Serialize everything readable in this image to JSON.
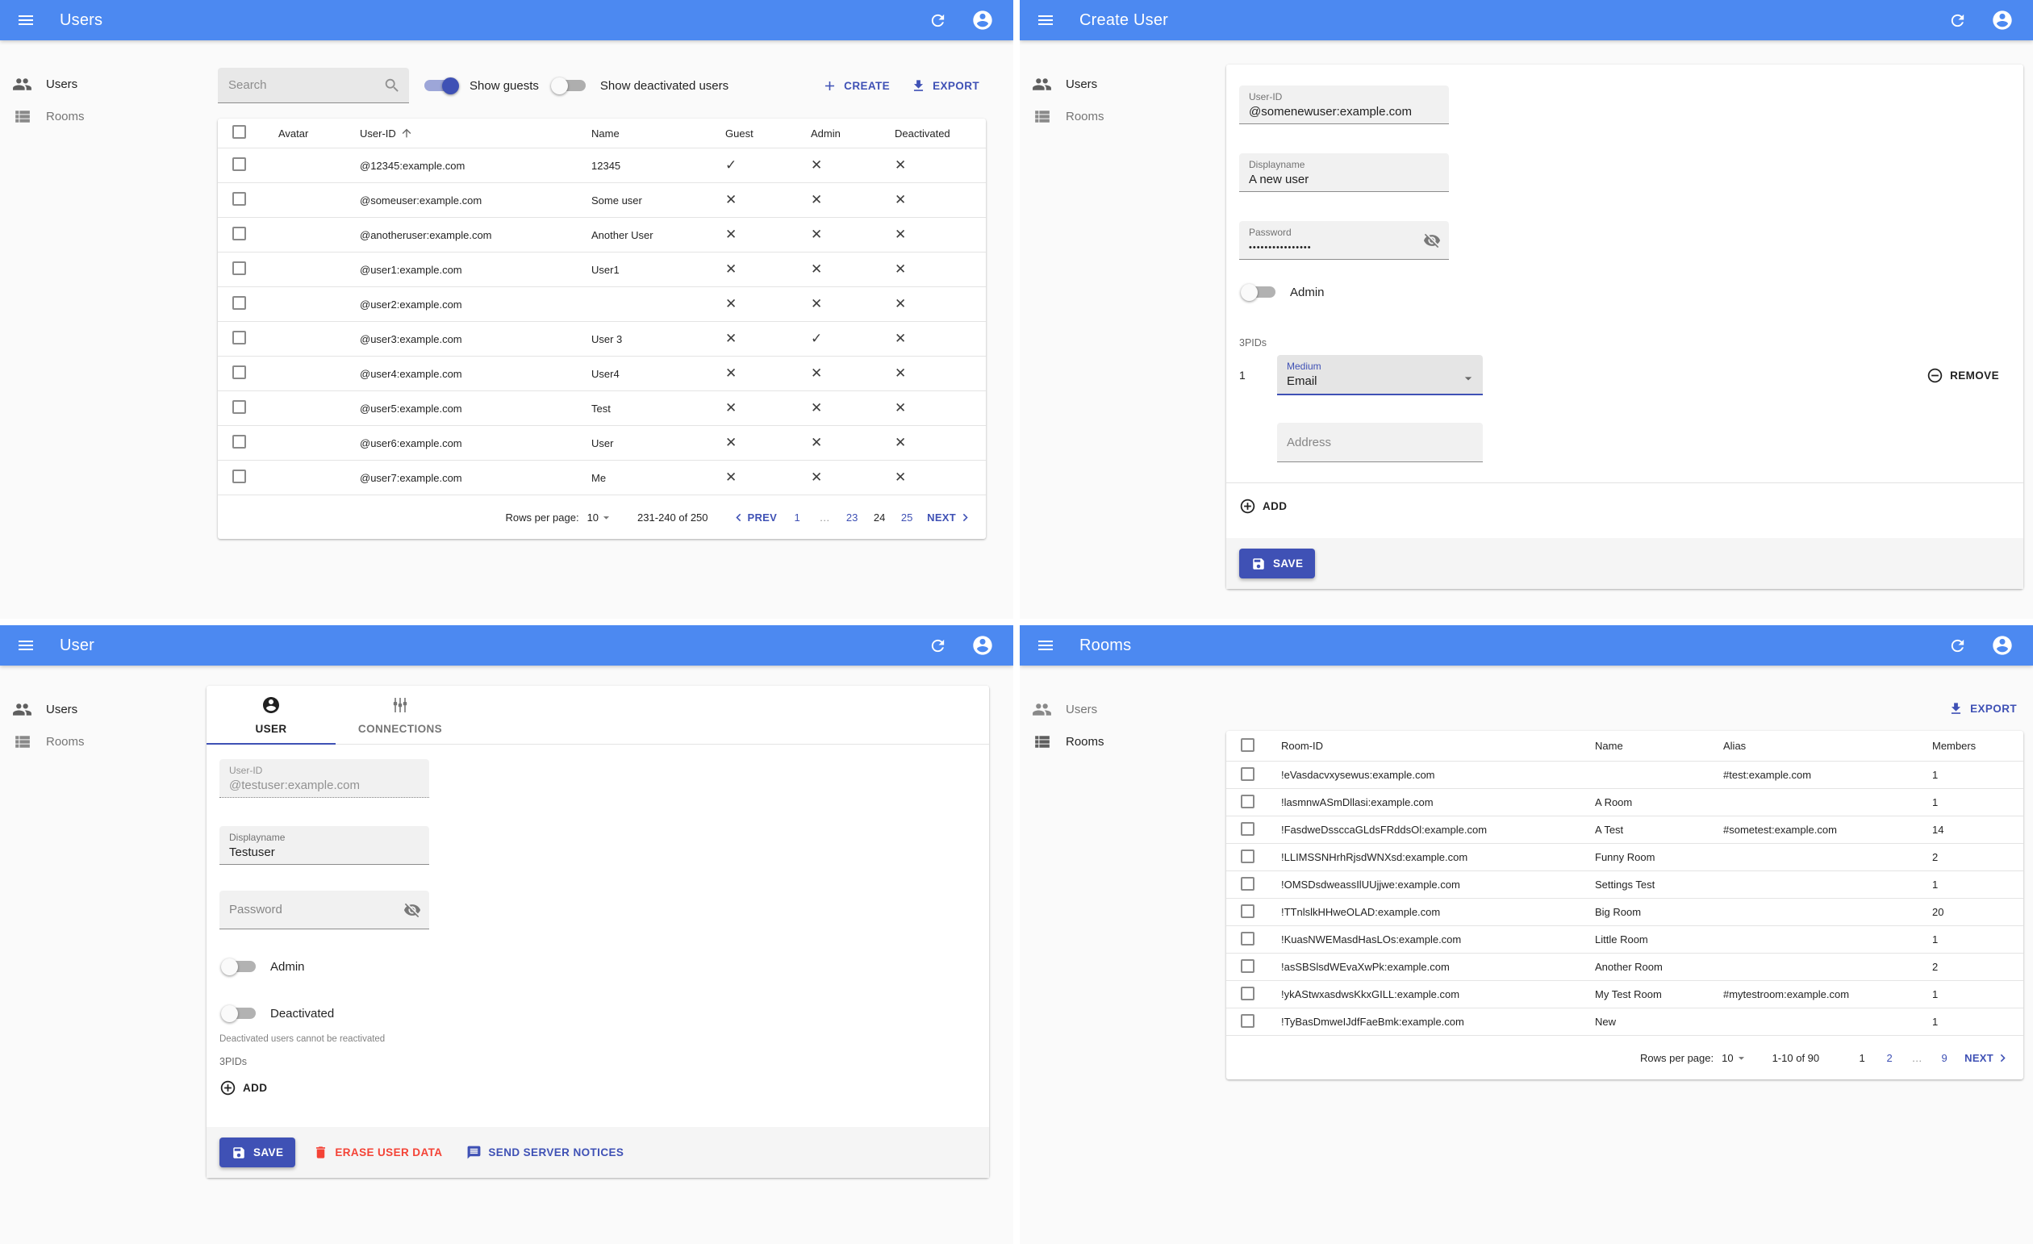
{
  "colors": {
    "appbar": "#4c89f1",
    "primary": "#3f51b5",
    "danger": "#f44336"
  },
  "icons": {
    "check": "✓",
    "cross": "✕"
  },
  "sidebar": {
    "users": "Users",
    "rooms": "Rooms"
  },
  "users_list": {
    "title": "Users",
    "search_placeholder": "Search",
    "show_guests": "Show guests",
    "show_deactivated": "Show deactivated users",
    "create": "CREATE",
    "export": "EXPORT",
    "headers": {
      "avatar": "Avatar",
      "user_id": "User-ID",
      "name": "Name",
      "guest": "Guest",
      "admin": "Admin",
      "deactivated": "Deactivated"
    },
    "rows": [
      {
        "user_id": "@12345:example.com",
        "name": "12345",
        "guest": true,
        "admin": false,
        "deactivated": false
      },
      {
        "user_id": "@someuser:example.com",
        "name": "Some user",
        "guest": false,
        "admin": false,
        "deactivated": false
      },
      {
        "user_id": "@anotheruser:example.com",
        "name": "Another User",
        "guest": false,
        "admin": false,
        "deactivated": false
      },
      {
        "user_id": "@user1:example.com",
        "name": "User1",
        "guest": false,
        "admin": false,
        "deactivated": false
      },
      {
        "user_id": "@user2:example.com",
        "name": "",
        "guest": false,
        "admin": false,
        "deactivated": false
      },
      {
        "user_id": "@user3:example.com",
        "name": "User 3",
        "guest": false,
        "admin": true,
        "deactivated": false
      },
      {
        "user_id": "@user4:example.com",
        "name": "User4",
        "guest": false,
        "admin": false,
        "deactivated": false
      },
      {
        "user_id": "@user5:example.com",
        "name": "Test",
        "guest": false,
        "admin": false,
        "deactivated": false
      },
      {
        "user_id": "@user6:example.com",
        "name": "User",
        "guest": false,
        "admin": false,
        "deactivated": false
      },
      {
        "user_id": "@user7:example.com",
        "name": "Me",
        "guest": false,
        "admin": false,
        "deactivated": false
      }
    ],
    "pagination": {
      "label": "Rows per page:",
      "per_page": "10",
      "range": "231-240 of 250",
      "prev": "PREV",
      "next": "NEXT",
      "pages": [
        {
          "t": "1"
        },
        {
          "t": "…",
          "dots": true
        },
        {
          "t": "23"
        },
        {
          "t": "24",
          "current": true
        },
        {
          "t": "25"
        }
      ]
    }
  },
  "create_user": {
    "title": "Create User",
    "user_id_label": "User-ID",
    "user_id_value": "@somenewuser:example.com",
    "displayname_label": "Displayname",
    "displayname_value": "A new user",
    "password_label": "Password",
    "password_value": "••••••••••••••••",
    "admin_label": "Admin",
    "threepids_label": "3PIDs",
    "row_index": "1",
    "medium_label": "Medium",
    "medium_value": "Email",
    "address_placeholder": "Address",
    "remove_label": "REMOVE",
    "add_label": "ADD",
    "save_label": "SAVE"
  },
  "user_edit": {
    "title": "User",
    "tab_user": "USER",
    "tab_connections": "CONNECTIONS",
    "user_id_label": "User-ID",
    "user_id_value": "@testuser:example.com",
    "displayname_label": "Displayname",
    "displayname_value": "Testuser",
    "password_placeholder": "Password",
    "admin_label": "Admin",
    "deactivated_label": "Deactivated",
    "deactivated_help": "Deactivated users cannot be reactivated",
    "threepids_label": "3PIDs",
    "add_label": "ADD",
    "save_label": "SAVE",
    "erase_label": "ERASE USER DATA",
    "notices_label": "SEND SERVER NOTICES"
  },
  "rooms_list": {
    "title": "Rooms",
    "export": "EXPORT",
    "headers": {
      "room_id": "Room-ID",
      "name": "Name",
      "alias": "Alias",
      "members": "Members"
    },
    "rows": [
      {
        "room_id": "!eVasdacvxysewus:example.com",
        "name": "",
        "alias": "#test:example.com",
        "members": "1"
      },
      {
        "room_id": "!lasmnwASmDllasi:example.com",
        "name": "A Room",
        "alias": "",
        "members": "1"
      },
      {
        "room_id": "!FasdweDssccaGLdsFRddsOl:example.com",
        "name": "A Test",
        "alias": "#sometest:example.com",
        "members": "14"
      },
      {
        "room_id": "!LLIMSSNHrhRjsdWNXsd:example.com",
        "name": "Funny Room",
        "alias": "",
        "members": "2"
      },
      {
        "room_id": "!OMSDsdweassIlUUjjwe:example.com",
        "name": "Settings Test",
        "alias": "",
        "members": "1"
      },
      {
        "room_id": "!TTnlslkHHweOLAD:example.com",
        "name": "Big Room",
        "alias": "",
        "members": "20"
      },
      {
        "room_id": "!KuasNWEMasdHasLOs:example.com",
        "name": "Little Room",
        "alias": "",
        "members": "1"
      },
      {
        "room_id": "!asSBSlsdWEvaXwPk:example.com",
        "name": "Another Room",
        "alias": "",
        "members": "2"
      },
      {
        "room_id": "!ykAStwxasdwsKkxGILL:example.com",
        "name": "My Test Room",
        "alias": "#mytestroom:example.com",
        "members": "1"
      },
      {
        "room_id": "!TyBasDmweIJdfFaeBmk:example.com",
        "name": "New",
        "alias": "",
        "members": "1"
      }
    ],
    "pagination": {
      "label": "Rows per page:",
      "per_page": "10",
      "range": "1-10 of 90",
      "next": "NEXT",
      "pages": [
        {
          "t": "1",
          "current": true
        },
        {
          "t": "2"
        },
        {
          "t": "…",
          "dots": true
        },
        {
          "t": "9"
        }
      ]
    }
  }
}
